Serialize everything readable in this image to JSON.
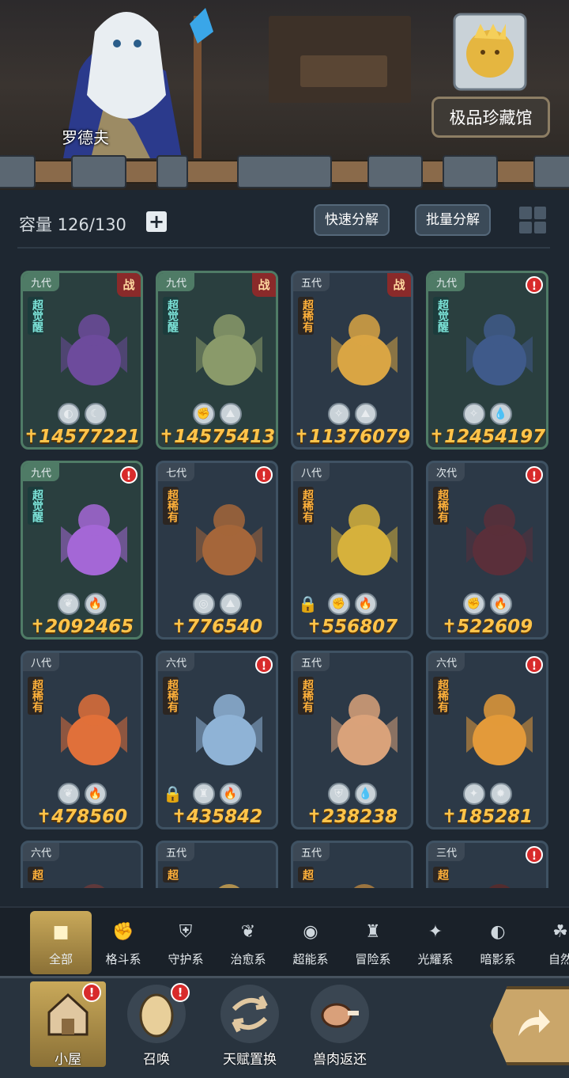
{
  "banner": {
    "npc_name": "罗德夫",
    "collection_label": "极品珍藏馆"
  },
  "inventory": {
    "capacity_label": "容量 126/130",
    "quick_decompose": "快速分解",
    "batch_decompose": "批量分解"
  },
  "cards": [
    {
      "gen": "九代",
      "rarity": "超觉醒",
      "awake": true,
      "corner": "战",
      "power": "14577221",
      "badges": [
        "dark-eye-icon",
        "moon-icon"
      ],
      "hue": "#6d4b9c"
    },
    {
      "gen": "九代",
      "rarity": "超觉醒",
      "awake": true,
      "corner": "战",
      "power": "14575413",
      "badges": [
        "fist-icon",
        "earth-icon"
      ],
      "hue": "#8a9a6a"
    },
    {
      "gen": "五代",
      "rarity": "超稀有",
      "awake": false,
      "corner": "战",
      "power": "11376079",
      "badges": [
        "light-icon",
        "earth-icon"
      ],
      "hue": "#d9a544"
    },
    {
      "gen": "九代",
      "rarity": "超觉醒",
      "awake": true,
      "corner": "!",
      "power": "12454197",
      "badges": [
        "light-icon",
        "water-icon"
      ],
      "hue": "#3f5a8a"
    },
    {
      "gen": "九代",
      "rarity": "超觉醒",
      "awake": true,
      "corner": "!",
      "power": "2092465",
      "badges": [
        "leaf-icon",
        "fire-icon"
      ],
      "hue": "#a467d6"
    },
    {
      "gen": "七代",
      "rarity": "超稀有",
      "awake": false,
      "corner": "!",
      "power": "776540",
      "badges": [
        "target-icon",
        "earth-icon"
      ],
      "hue": "#a5663a"
    },
    {
      "gen": "八代",
      "rarity": "超稀有",
      "awake": false,
      "corner": "",
      "power": "556807",
      "badges": [
        "fist-icon",
        "fire-icon"
      ],
      "hue": "#d6b13c",
      "locked": true
    },
    {
      "gen": "次代",
      "rarity": "超稀有",
      "awake": false,
      "corner": "!",
      "power": "522609",
      "badges": [
        "fist-icon",
        "fire-icon"
      ],
      "hue": "#5a2f3a"
    },
    {
      "gen": "八代",
      "rarity": "超稀有",
      "awake": false,
      "corner": "",
      "power": "478560",
      "badges": [
        "leaf-icon",
        "fire-icon"
      ],
      "hue": "#e0703a"
    },
    {
      "gen": "六代",
      "rarity": "超稀有",
      "awake": false,
      "corner": "!",
      "power": "435842",
      "badges": [
        "adventure-icon",
        "fire-icon"
      ],
      "hue": "#8fb3d6",
      "locked": true
    },
    {
      "gen": "五代",
      "rarity": "超稀有",
      "awake": false,
      "corner": "",
      "power": "238238",
      "badges": [
        "shield-icon",
        "water-icon"
      ],
      "hue": "#d9a27a"
    },
    {
      "gen": "六代",
      "rarity": "超稀有",
      "awake": false,
      "corner": "!",
      "power": "185281",
      "badges": [
        "star-light-icon",
        "sun-icon"
      ],
      "hue": "#e39a3a"
    },
    {
      "gen": "六代",
      "rarity": "超",
      "awake": false,
      "corner": "",
      "power": "",
      "badges": [],
      "hue": "#6a3a3a"
    },
    {
      "gen": "五代",
      "rarity": "超",
      "awake": false,
      "corner": "",
      "power": "",
      "badges": [],
      "hue": "#c8a050"
    },
    {
      "gen": "五代",
      "rarity": "超",
      "awake": false,
      "corner": "",
      "power": "",
      "badges": [],
      "hue": "#b08040"
    },
    {
      "gen": "三代",
      "rarity": "超",
      "awake": false,
      "corner": "!",
      "power": "",
      "badges": [],
      "hue": "#5a2a2a"
    }
  ],
  "categories": [
    {
      "label": "全部",
      "icon": "all-icon",
      "glyph": "■"
    },
    {
      "label": "格斗系",
      "icon": "fist-icon",
      "glyph": "✊"
    },
    {
      "label": "守护系",
      "icon": "shield-icon",
      "glyph": "⛨"
    },
    {
      "label": "治愈系",
      "icon": "leaf-icon",
      "glyph": "❦"
    },
    {
      "label": "超能系",
      "icon": "alien-icon",
      "glyph": "◉"
    },
    {
      "label": "冒险系",
      "icon": "adventure-icon",
      "glyph": "♜"
    },
    {
      "label": "光耀系",
      "icon": "star-light-icon",
      "glyph": "✦"
    },
    {
      "label": "暗影系",
      "icon": "dark-eye-icon",
      "glyph": "◐"
    },
    {
      "label": "自然",
      "icon": "nature-icon",
      "glyph": "☘"
    }
  ],
  "nav": {
    "house": "小屋",
    "summon": "召唤",
    "talent": "天赋置换",
    "meat": "兽肉返还"
  },
  "colors": {
    "power_gold": "#ffc44a",
    "alert_red": "#d82b2b",
    "active_gold": "#c9a95a"
  }
}
